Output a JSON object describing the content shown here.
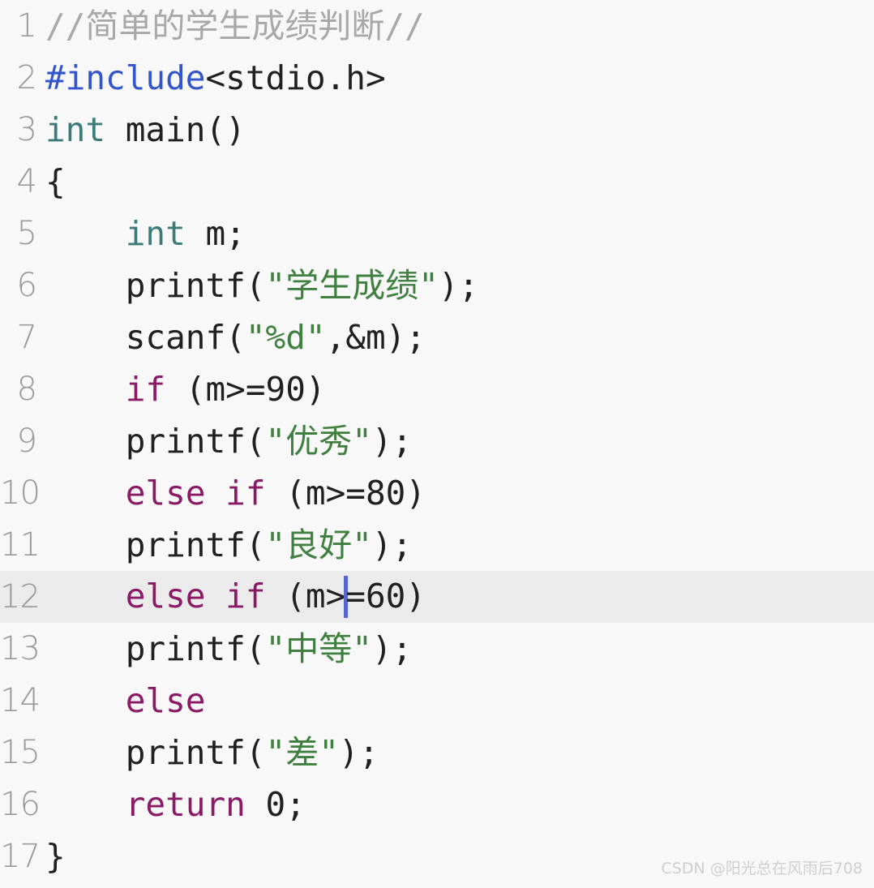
{
  "editor": {
    "background_color": "#f8f8f8",
    "active_line_color": "#ebebeb",
    "gutter_color": "#9a9a9a",
    "caret_color": "#5566cc",
    "active_line_number": 12,
    "total_lines": 17,
    "language": "c",
    "syntax_colors": {
      "comment": "#a8a8a8",
      "preprocessor": "#3355cc",
      "type": "#3d7b7b",
      "keyword": "#8b1a66",
      "string": "#3f7f3f",
      "plain": "#202020"
    }
  },
  "lines": [
    {
      "number": "1",
      "tokens": [
        {
          "text": "//简单的学生成绩判断//",
          "kind": "comment"
        }
      ]
    },
    {
      "number": "2",
      "tokens": [
        {
          "text": "#include",
          "kind": "pre"
        },
        {
          "text": "<stdio.h>",
          "kind": "plain"
        }
      ]
    },
    {
      "number": "3",
      "tokens": [
        {
          "text": "int",
          "kind": "type"
        },
        {
          "text": " main()",
          "kind": "plain"
        }
      ]
    },
    {
      "number": "4",
      "tokens": [
        {
          "text": "{",
          "kind": "plain"
        }
      ]
    },
    {
      "number": "5",
      "tokens": [
        {
          "text": "    ",
          "kind": "plain"
        },
        {
          "text": "int",
          "kind": "type"
        },
        {
          "text": " m;",
          "kind": "plain"
        }
      ]
    },
    {
      "number": "6",
      "tokens": [
        {
          "text": "    printf(",
          "kind": "plain"
        },
        {
          "text": "\"学生成绩\"",
          "kind": "str"
        },
        {
          "text": ");",
          "kind": "plain"
        }
      ]
    },
    {
      "number": "7",
      "tokens": [
        {
          "text": "    scanf(",
          "kind": "plain"
        },
        {
          "text": "\"%d\"",
          "kind": "str"
        },
        {
          "text": ",&m);",
          "kind": "plain"
        }
      ]
    },
    {
      "number": "8",
      "tokens": [
        {
          "text": "    ",
          "kind": "plain"
        },
        {
          "text": "if",
          "kind": "kw"
        },
        {
          "text": " (m>=90)",
          "kind": "plain"
        }
      ]
    },
    {
      "number": "9",
      "tokens": [
        {
          "text": "    printf(",
          "kind": "plain"
        },
        {
          "text": "\"优秀\"",
          "kind": "str"
        },
        {
          "text": ");",
          "kind": "plain"
        }
      ]
    },
    {
      "number": "10",
      "tokens": [
        {
          "text": "    ",
          "kind": "plain"
        },
        {
          "text": "else if",
          "kind": "kw"
        },
        {
          "text": " (m>=80)",
          "kind": "plain"
        }
      ]
    },
    {
      "number": "11",
      "tokens": [
        {
          "text": "    printf(",
          "kind": "plain"
        },
        {
          "text": "\"良好\"",
          "kind": "str"
        },
        {
          "text": ");",
          "kind": "plain"
        }
      ]
    },
    {
      "number": "12",
      "active": true,
      "tokens": [
        {
          "text": "    ",
          "kind": "plain"
        },
        {
          "text": "else if",
          "kind": "kw"
        },
        {
          "text": " (m>",
          "kind": "plain"
        },
        {
          "text": "",
          "kind": "caret"
        },
        {
          "text": "=60)",
          "kind": "plain"
        }
      ]
    },
    {
      "number": "13",
      "tokens": [
        {
          "text": "    printf(",
          "kind": "plain"
        },
        {
          "text": "\"中等\"",
          "kind": "str"
        },
        {
          "text": ");",
          "kind": "plain"
        }
      ]
    },
    {
      "number": "14",
      "tokens": [
        {
          "text": "    ",
          "kind": "plain"
        },
        {
          "text": "else",
          "kind": "kw"
        }
      ]
    },
    {
      "number": "15",
      "tokens": [
        {
          "text": "    printf(",
          "kind": "plain"
        },
        {
          "text": "\"差\"",
          "kind": "str"
        },
        {
          "text": ");",
          "kind": "plain"
        }
      ]
    },
    {
      "number": "16",
      "tokens": [
        {
          "text": "    ",
          "kind": "plain"
        },
        {
          "text": "return",
          "kind": "kw"
        },
        {
          "text": " 0;",
          "kind": "plain"
        }
      ]
    },
    {
      "number": "17",
      "tokens": [
        {
          "text": "}",
          "kind": "plain"
        }
      ]
    }
  ],
  "watermark": {
    "text": "CSDN @阳光总在风雨后708"
  }
}
